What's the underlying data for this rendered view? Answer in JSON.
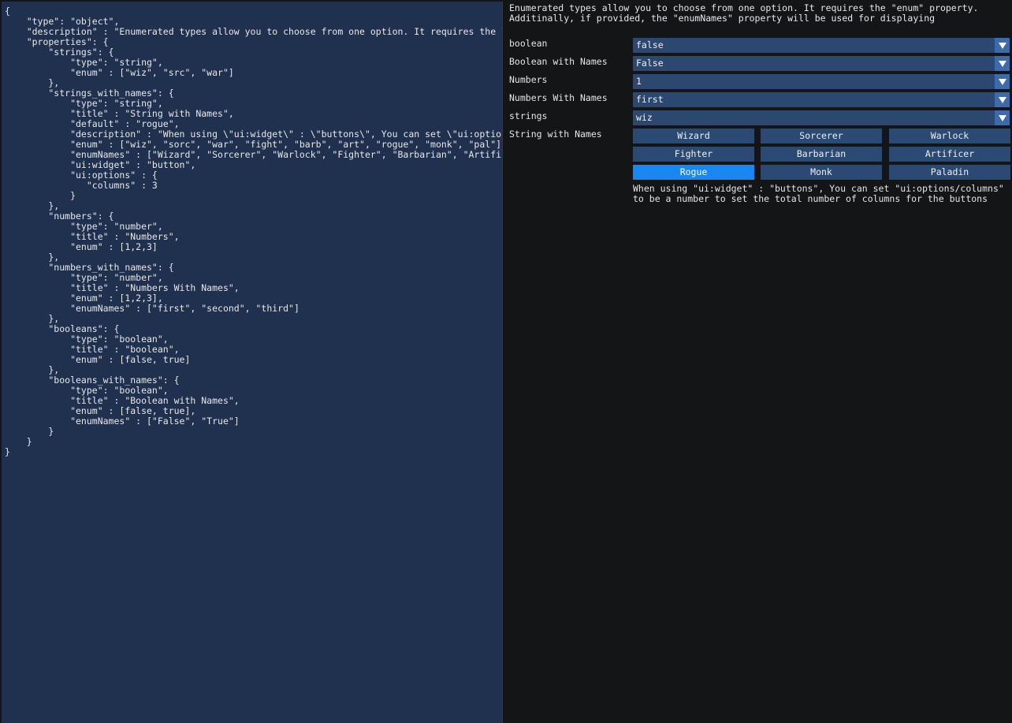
{
  "editor": {
    "text": "{\n    \"type\": \"object\",\n    \"description\" : \"Enumerated types allow you to choose from one option. It requires the \\\"enum\\\"\n    \"properties\": {\n        \"strings\": {\n            \"type\": \"string\",\n            \"enum\" : [\"wiz\", \"src\", \"war\"]\n        },\n        \"strings_with_names\": {\n            \"type\": \"string\",\n            \"title\" : \"String with Names\",\n            \"default\" : \"rogue\",\n            \"description\" : \"When using \\\"ui:widget\\\" : \\\"buttons\\\", You can set \\\"ui:options/columns\\\"\n            \"enum\" : [\"wiz\", \"sorc\", \"war\", \"fight\", \"barb\", \"art\", \"rogue\", \"monk\", \"pal\"],\n            \"enumNames\" : [\"Wizard\", \"Sorcerer\", \"Warlock\", \"Fighter\", \"Barbarian\", \"Artificer\"\n            \"ui:widget\" : \"button\",\n            \"ui:options\" : {\n               \"columns\" : 3\n            }\n        },\n        \"numbers\": {\n            \"type\": \"number\",\n            \"title\" : \"Numbers\",\n            \"enum\" : [1,2,3]\n        },\n        \"numbers_with_names\": {\n            \"type\": \"number\",\n            \"title\" : \"Numbers With Names\",\n            \"enum\" : [1,2,3],\n            \"enumNames\" : [\"first\", \"second\", \"third\"]\n        },\n        \"booleans\": {\n            \"type\": \"boolean\",\n            \"title\" : \"boolean\",\n            \"enum\" : [false, true]\n        },\n        \"booleans_with_names\": {\n            \"type\": \"boolean\",\n            \"title\" : \"Boolean with Names\",\n            \"enum\" : [false, true],\n            \"enumNames\" : [\"False\", \"True\"]\n        }\n    }\n}"
  },
  "form": {
    "description": "Enumerated types allow you to choose from one option. It requires the \"enum\" property.\nAdditinally, if provided, the \"enumNames\" property will be used for displaying",
    "fields": {
      "boolean": {
        "label": "boolean",
        "value": "false"
      },
      "boolean_with_names": {
        "label": "Boolean with Names",
        "value": "False"
      },
      "numbers": {
        "label": "Numbers",
        "value": "1"
      },
      "numbers_with_names": {
        "label": "Numbers With Names",
        "value": "first"
      },
      "strings": {
        "label": "strings",
        "value": "wiz"
      },
      "string_with_names": {
        "label": "String with Names",
        "options": [
          "Wizard",
          "Sorcerer",
          "Warlock",
          "Fighter",
          "Barbarian",
          "Artificer",
          "Rogue",
          "Monk",
          "Paladin"
        ],
        "selected": "Rogue",
        "help": "When using \"ui:widget\" : \"buttons\", You can set \"ui:options/columns\"\nto be a number to set the total number of columns for the buttons"
      }
    }
  },
  "colors": {
    "editor_bg": "#20304f",
    "window_bg": "#141517",
    "combo_bg": "#2c4770",
    "button_bg": "#2a4a74",
    "button_active": "#1a86f0"
  },
  "icons": {
    "combo_arrow": "chevron-down-icon"
  }
}
